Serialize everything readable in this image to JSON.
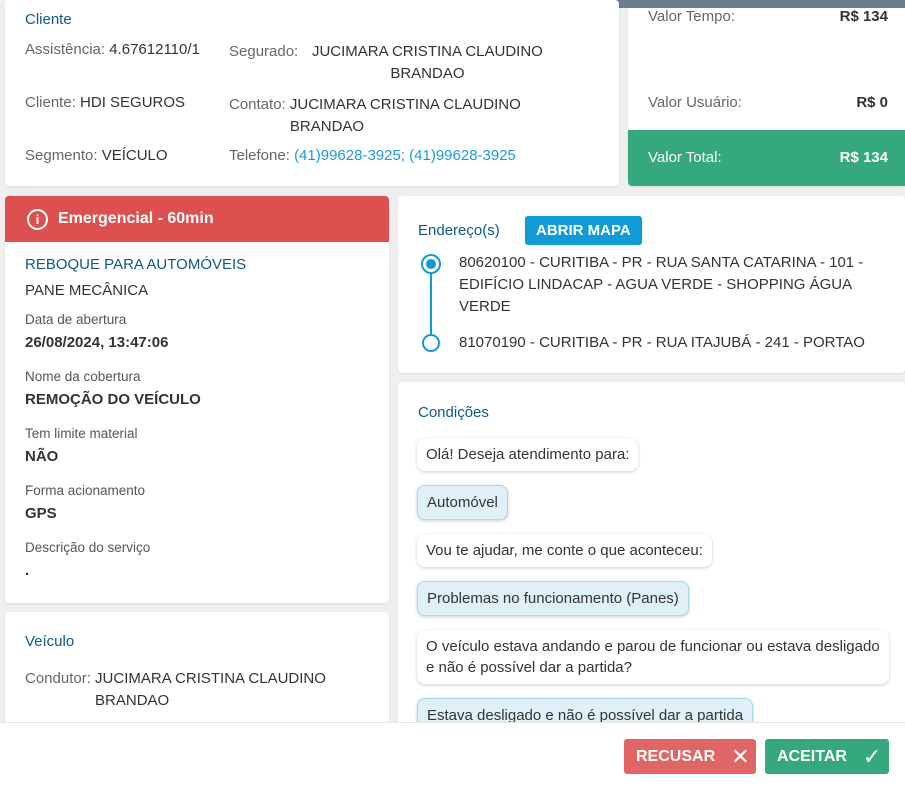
{
  "cliente": {
    "title": "Cliente",
    "assistencia_label": "Assistência:",
    "assistencia": "4.67612110/1",
    "segurado_label": "Segurado:",
    "segurado": "JUCIMARA CRISTINA CLAUDINO BRANDAO",
    "cliente_label": "Cliente:",
    "cliente": "HDI SEGUROS",
    "contato_label": "Contato:",
    "contato": "JUCIMARA CRISTINA CLAUDINO BRANDAO",
    "segmento_label": "Segmento:",
    "segmento": "VEÍCULO",
    "telefone_label": "Telefone:",
    "telefone": "(41)99628-3925; (41)99628-3925"
  },
  "valores": {
    "tempo_label": "Valor Tempo:",
    "tempo": "R$ 134",
    "usuario_label": "Valor Usuário:",
    "usuario": "R$ 0",
    "total_label": "Valor Total:",
    "total": "R$ 134",
    "total_color": "#35a97d"
  },
  "servico": {
    "priority": "Emergencial - 60min",
    "priority_color": "#dc5050",
    "tipo": "REBOQUE PARA AUTOMÓVEIS",
    "problema": "PANE MECÂNICA",
    "fields": [
      {
        "label": "Data de abertura",
        "value": "26/08/2024, 13:47:06"
      },
      {
        "label": "Nome da cobertura",
        "value": "REMOÇÃO DO VEÍCULO"
      },
      {
        "label": "Tem limite material",
        "value": "NÃO"
      },
      {
        "label": "Forma acionamento",
        "value": "GPS"
      },
      {
        "label": "Descrição do serviço",
        "value": "."
      }
    ]
  },
  "veiculo": {
    "title": "Veículo",
    "condutor_label": "Condutor:",
    "condutor": "JUCIMARA CRISTINA CLAUDINO BRANDAO"
  },
  "enderecos": {
    "title": "Endereço(s)",
    "map_button": "ABRIR MAPA",
    "items": [
      "80620100 - CURITIBA - PR - RUA SANTA CATARINA - 101 - EDIFÍCIO LINDACAP - AGUA VERDE - SHOPPING ÁGUA VERDE",
      "81070190 - CURITIBA - PR - RUA ITAJUBÁ - 241 - PORTAO"
    ]
  },
  "condicoes": {
    "title": "Condições",
    "messages": [
      {
        "text": "Olá! Deseja atendimento para:",
        "type": "question"
      },
      {
        "text": "Automóvel",
        "type": "answer"
      },
      {
        "text": "Vou te ajudar, me conte o que aconteceu:",
        "type": "question"
      },
      {
        "text": "Problemas no funcionamento (Panes)",
        "type": "answer"
      },
      {
        "text": "O veículo estava andando e parou de funcionar ou estava desligado e não é possível dar a partida?",
        "type": "question"
      },
      {
        "text": "Estava desligado e não é possível dar a partida",
        "type": "answer"
      }
    ]
  },
  "footer": {
    "recusar": "RECUSAR",
    "aceitar": "ACEITAR"
  }
}
